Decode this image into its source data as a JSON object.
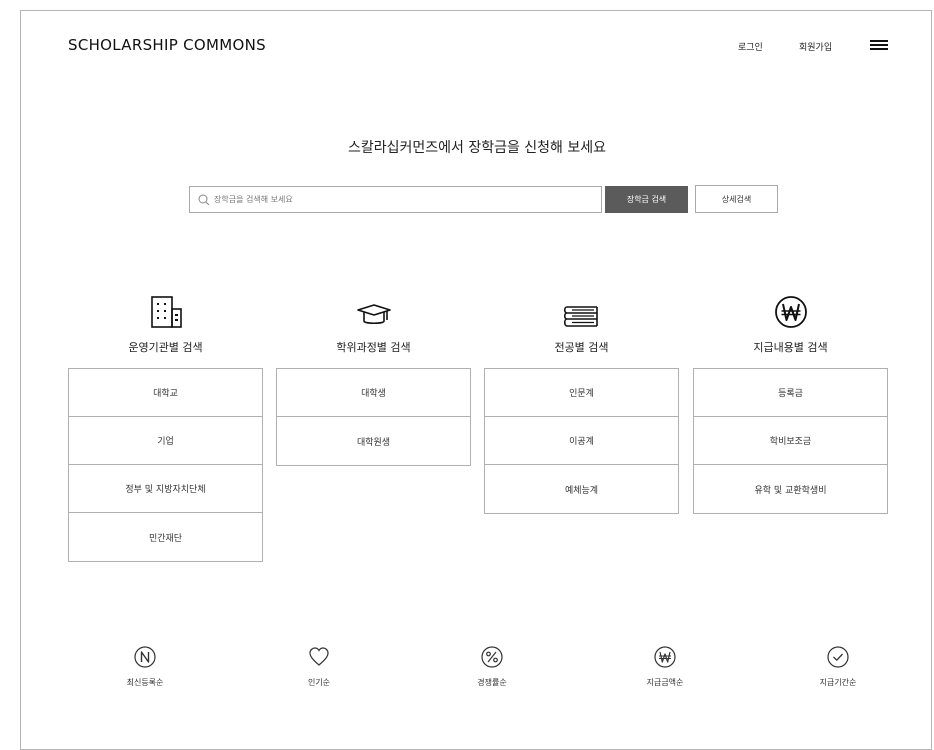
{
  "header": {
    "logo": "SCHOLARSHIP COMMONS",
    "login": "로그인",
    "signup": "회원가입",
    "menu_icon": "hamburger-menu-icon"
  },
  "hero": {
    "headline": "스칼라십커먼즈에서 장학금을 신청해 보세요",
    "search_placeholder": "장학금을 검색해 보세요",
    "search_button": "장학금 검색",
    "detail_button": "상세검색"
  },
  "categories": [
    {
      "title": "운영기관별 검색",
      "icon": "building-icon",
      "items": [
        "대학교",
        "기업",
        "정부 및 지방자치단체",
        "민간재단"
      ]
    },
    {
      "title": "학위과정별 검색",
      "icon": "graduation-cap-icon",
      "items": [
        "대학생",
        "대학원생"
      ]
    },
    {
      "title": "전공별 검색",
      "icon": "books-icon",
      "items": [
        "인문계",
        "이공계",
        "예체능계"
      ]
    },
    {
      "title": "지급내용별 검색",
      "icon": "won-icon",
      "items": [
        "등록금",
        "학비보조금",
        "유학 및 교환학생비"
      ]
    }
  ],
  "sort_options": [
    {
      "label": "최신등록순",
      "icon": "new-n-icon"
    },
    {
      "label": "인기순",
      "icon": "heart-icon"
    },
    {
      "label": "경쟁률순",
      "icon": "percent-icon"
    },
    {
      "label": "지급금액순",
      "icon": "won-icon"
    },
    {
      "label": "지급기간순",
      "icon": "check-circle-icon"
    }
  ]
}
